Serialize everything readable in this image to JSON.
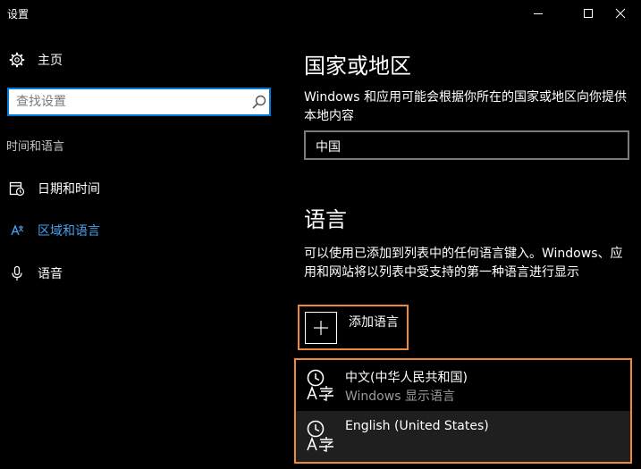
{
  "window": {
    "title": "设置",
    "controls": {
      "minimize": "minimize-icon",
      "maximize": "maximize-icon",
      "close": "close-icon"
    }
  },
  "sidebar": {
    "home": {
      "label": "主页",
      "icon": "gear-icon"
    },
    "search": {
      "placeholder": "查找设置",
      "value": "",
      "icon": "search-icon"
    },
    "section_label": "时间和语言",
    "items": [
      {
        "label": "日期和时间",
        "icon": "calendar-clock-icon",
        "active": false
      },
      {
        "label": "区域和语言",
        "icon": "region-language-icon",
        "active": true
      },
      {
        "label": "语音",
        "icon": "microphone-icon",
        "active": false
      }
    ]
  },
  "main": {
    "region": {
      "title": "国家或地区",
      "description": "Windows 和应用可能会根据你所在的国家或地区向你提供本地内容",
      "selected_country": "中国"
    },
    "language": {
      "title": "语言",
      "description": "可以使用已添加到列表中的任何语言键入。Windows、应用和网站将以列表中受支持的第一种语言进行显示",
      "add_label": "添加语言",
      "languages": [
        {
          "name": "中文(中华人民共和国)",
          "sub": "Windows 显示语言",
          "icon": "language-clock-icon"
        },
        {
          "name": "English (United States)",
          "sub": "",
          "icon": "language-clock-icon"
        }
      ]
    }
  },
  "colors": {
    "background": "#000000",
    "accent": "#0078d7",
    "active_nav": "#4aa0f0",
    "highlight_border": "#f0883a",
    "selected_row": "#1f1f1f"
  }
}
